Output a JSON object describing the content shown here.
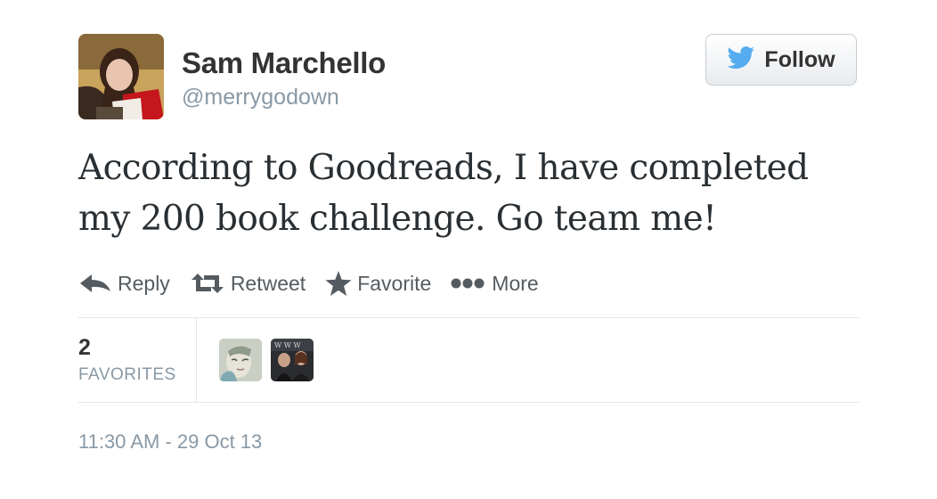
{
  "user": {
    "name": "Sam Marchello",
    "handle": "@merrygodown"
  },
  "follow_button": {
    "label": "Follow",
    "icon": "twitter-bird-icon"
  },
  "tweet": {
    "text": "According to Goodreads, I have completed my 200 book challenge. Go team me!"
  },
  "actions": [
    {
      "label": "Reply",
      "icon": "reply-arrow-icon"
    },
    {
      "label": "Retweet",
      "icon": "retweet-icon"
    },
    {
      "label": "Favorite",
      "icon": "star-icon"
    },
    {
      "label": "More",
      "icon": "ellipsis-icon"
    }
  ],
  "stats": {
    "favorites_count": "2",
    "favorites_label": "FAVORITES"
  },
  "timestamp": "11:30 AM - 29 Oct 13",
  "colors": {
    "brand_blue": "#55acee",
    "text_muted": "#8899a6",
    "text_main": "#292f33"
  }
}
